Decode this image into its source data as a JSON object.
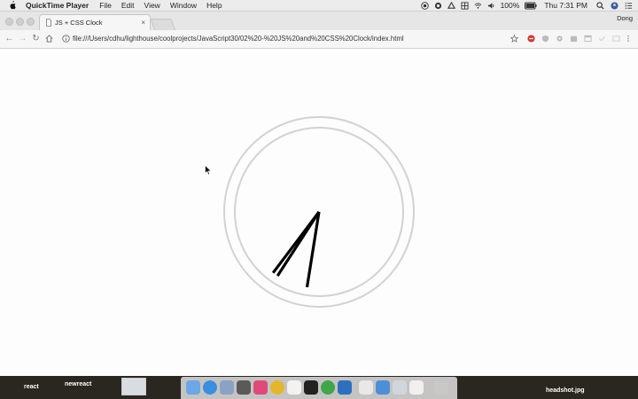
{
  "menubar": {
    "app_name": "QuickTime Player",
    "menus": [
      "File",
      "Edit",
      "View",
      "Window",
      "Help"
    ],
    "battery": "100%",
    "clock": "Thu 7:31 PM"
  },
  "browser": {
    "tab_title": "JS + CSS Clock",
    "tab_close": "×",
    "profile_name": "Dong",
    "url": "file:///Users/cdhu/lighthouse/coolprojects/JavaScript30/02%20-%20JS%20and%20CSS%20Clock/index.html"
  },
  "clock": {
    "hands": {
      "hour_angle_deg": 213,
      "minute_angle_deg": 189,
      "second_angle_deg": 217
    }
  },
  "desktop": {
    "left_labels": [
      "react",
      "newreact"
    ],
    "right_label": "headshot.jpg"
  },
  "colors": {
    "clock_border": "#d0d0d0",
    "hand": "#000000"
  }
}
